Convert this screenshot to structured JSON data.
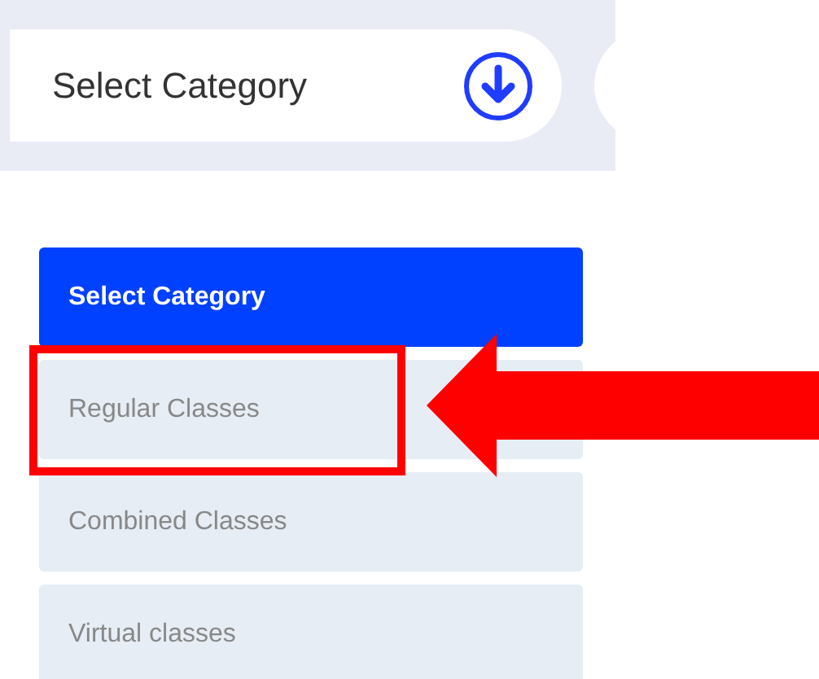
{
  "category_select": {
    "label": "Select Category"
  },
  "dropdown": {
    "header": "Select Category",
    "items": [
      {
        "label": "Regular Classes",
        "highlighted": true
      },
      {
        "label": "Combined Classes",
        "highlighted": false
      },
      {
        "label": "Virtual classes",
        "highlighted": false
      }
    ]
  }
}
